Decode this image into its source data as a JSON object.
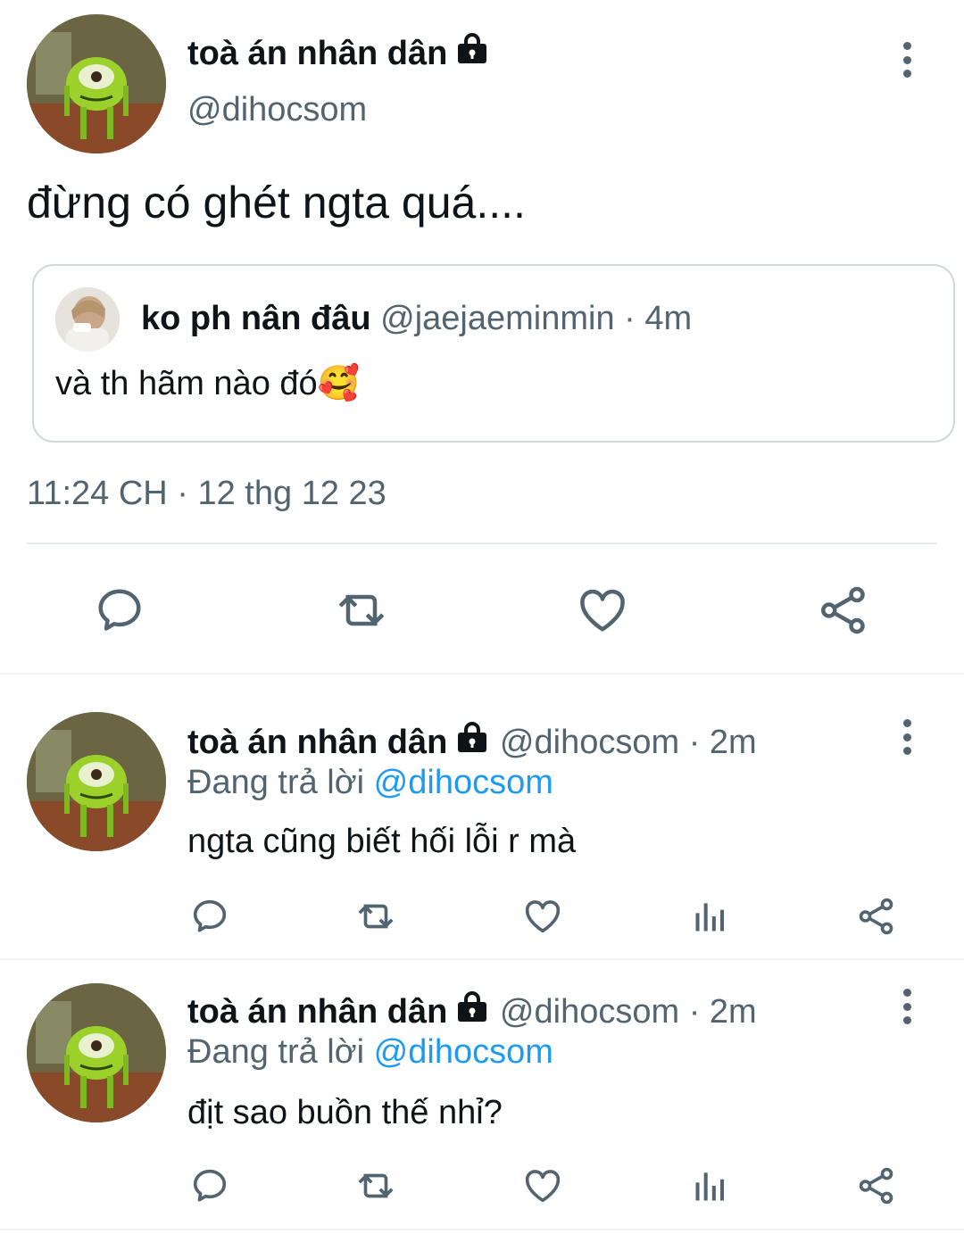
{
  "main_tweet": {
    "display_name": "toà án nhân dân",
    "handle": "@dihocsom",
    "text": "đừng có ghét ngta quá....",
    "timestamp": "11:24 CH · 12 thg 12 23",
    "quoted": {
      "display_name": "ko ph nân đâu",
      "handle": "@jaejaeminmin",
      "time": "· 4m",
      "text": "và th hãm nào đó🥰"
    },
    "actions": [
      "reply-icon",
      "retweet-icon",
      "like-icon",
      "share-icon"
    ]
  },
  "replies": [
    {
      "display_name": "toà án nhân dân",
      "handle": "@dihocsom",
      "time": "· 2m",
      "replying_prefix": "Đang trả lời",
      "replying_to": "@dihocsom",
      "text": "ngta cũng biết hối lỗi r mà"
    },
    {
      "display_name": "toà án nhân dân",
      "handle": "@dihocsom",
      "time": "· 2m",
      "replying_prefix": "Đang trả lời",
      "replying_to": "@dihocsom",
      "text": "địt sao buồn thế nhỉ?"
    }
  ],
  "colors": {
    "text": "#0f1419",
    "secondary": "#536471",
    "accent": "#1d9bf0",
    "border": "#cfd9de"
  }
}
